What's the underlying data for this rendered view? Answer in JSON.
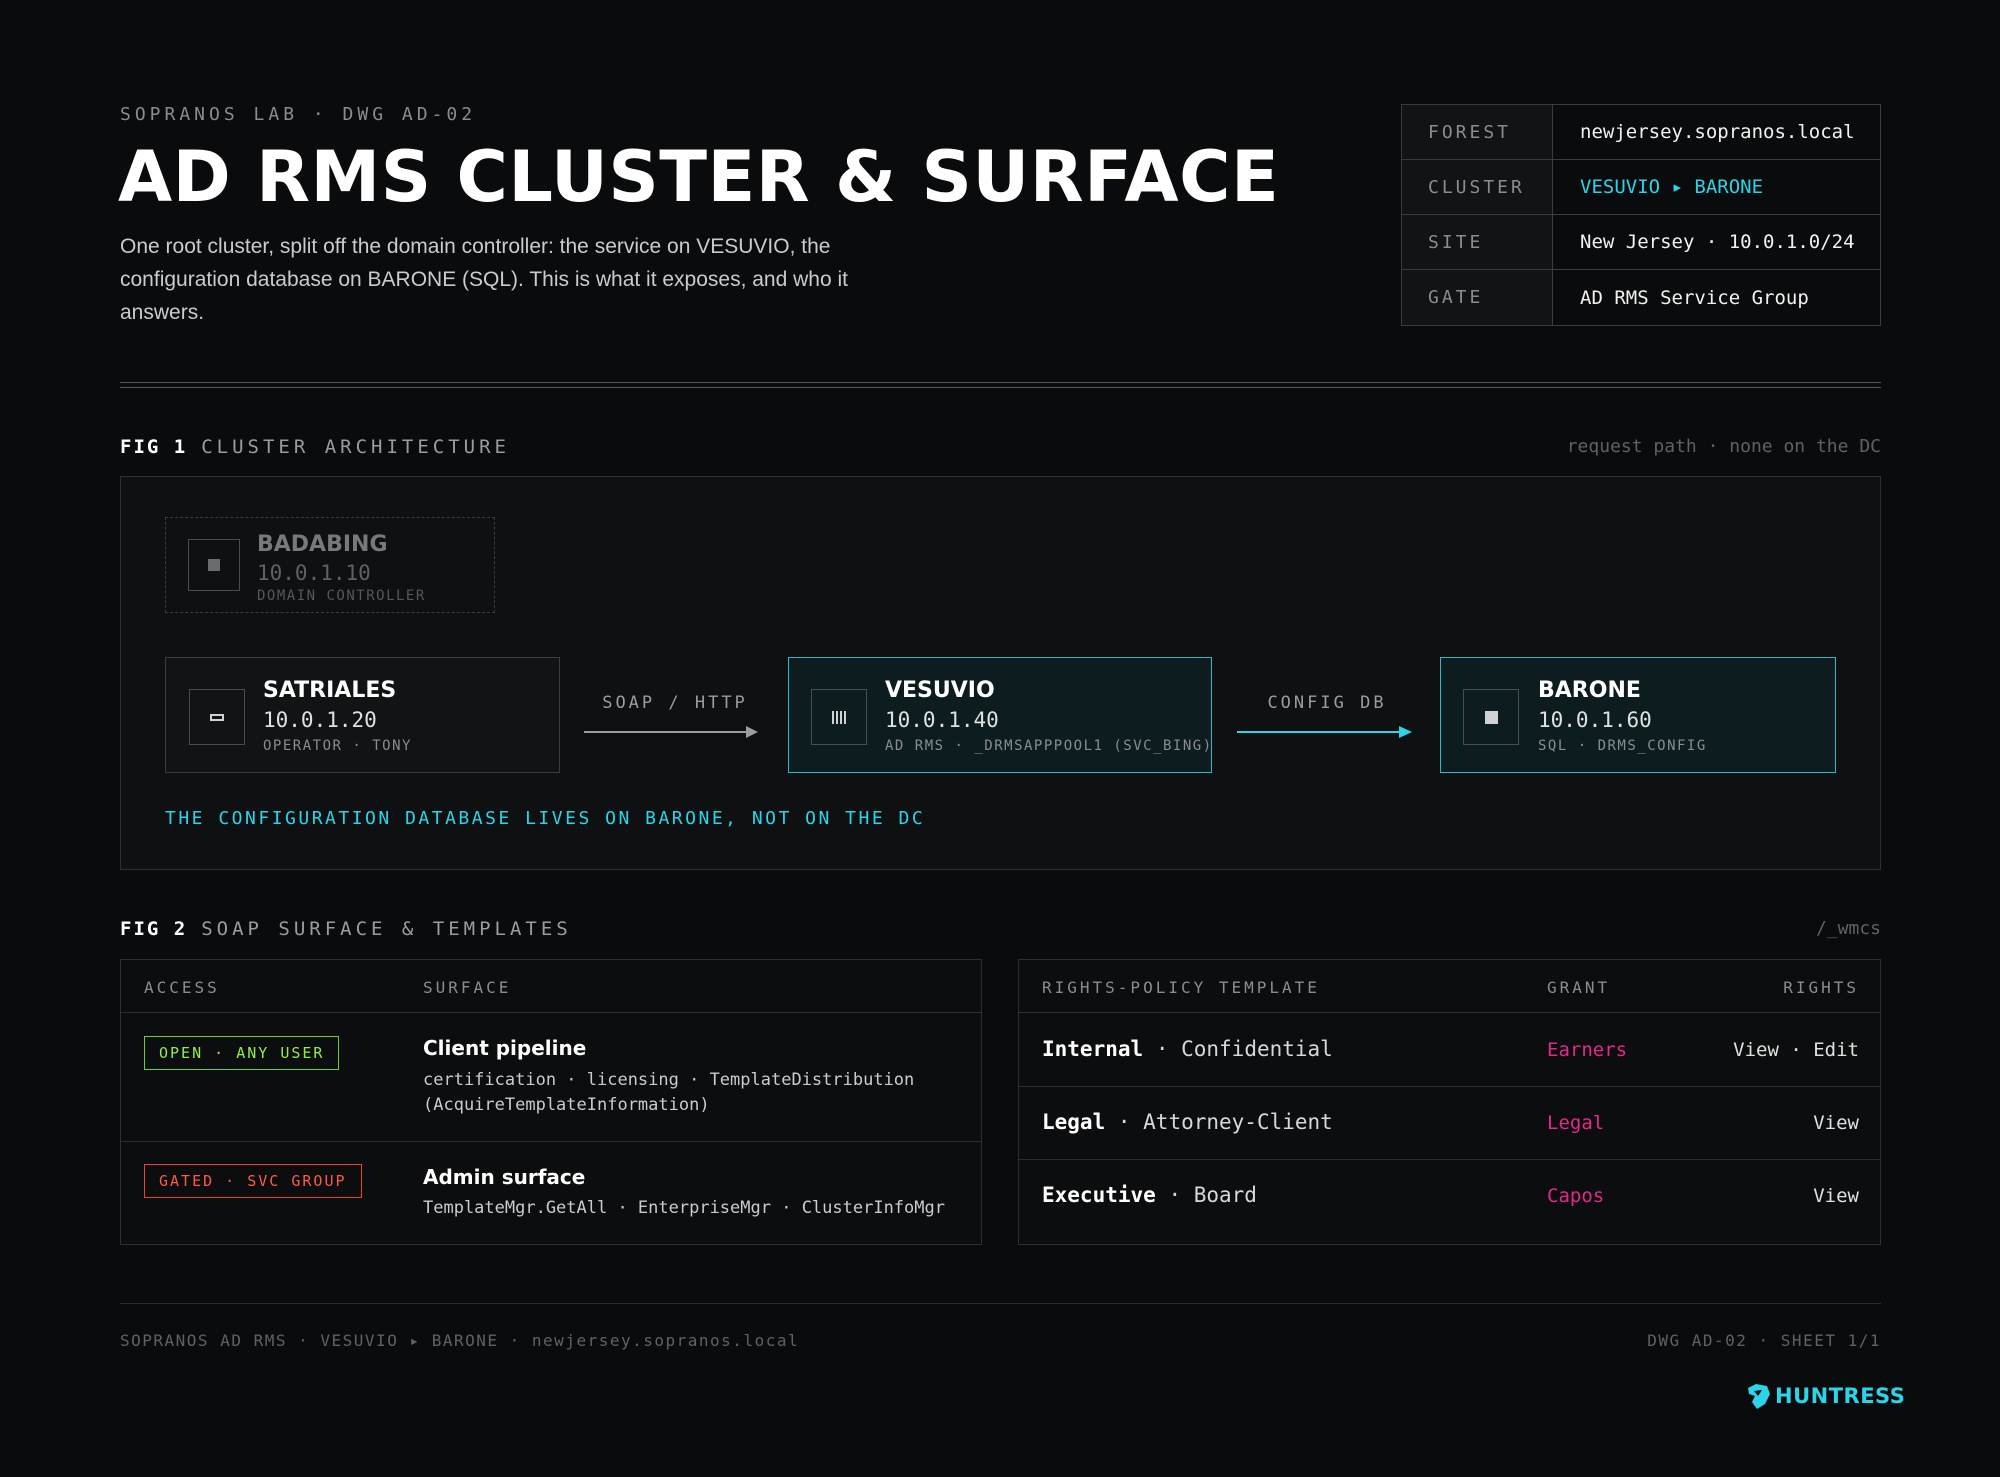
{
  "header": {
    "eyebrow": "SOPRANOS LAB · DWG AD-02",
    "title": "AD RMS CLUSTER & SURFACE",
    "lede": "One root cluster, split off the domain controller: the service on VESUVIO, the configuration database on BARONE (SQL). This is what it exposes, and who it answers."
  },
  "meta": [
    {
      "key": "FOREST",
      "value": "newjersey.sopranos.local"
    },
    {
      "key": "CLUSTER",
      "value": "VESUVIO ▸ BARONE"
    },
    {
      "key": "SITE",
      "value": "New Jersey · 10.0.1.0/24"
    },
    {
      "key": "GATE",
      "value": "AD RMS Service Group"
    }
  ],
  "fig1": {
    "num": "FIG 1",
    "title": "CLUSTER ARCHITECTURE",
    "note": "request path · none on the DC",
    "nodes": {
      "dc": {
        "name": "BADABING",
        "ip": "10.0.1.10",
        "role": "DOMAIN CONTROLLER"
      },
      "client": {
        "name": "SATRIALES",
        "ip": "10.0.1.20",
        "role": "OPERATOR · TONY"
      },
      "service": {
        "name": "VESUVIO",
        "ip": "10.0.1.40",
        "role": "AD RMS · _DRMSAPPPOOL1 (SVC_BING)"
      },
      "db": {
        "name": "BARONE",
        "ip": "10.0.1.60",
        "role": "SQL · DRMS_CONFIG"
      }
    },
    "edges": {
      "soap": "SOAP / HTTP",
      "config": "CONFIG DB"
    },
    "callout": "THE CONFIGURATION DATABASE LIVES ON BARONE, NOT ON THE DC"
  },
  "fig2": {
    "num": "FIG 2",
    "title": "SOAP SURFACE & TEMPLATES",
    "note": "/_wmcs",
    "surface": {
      "headers": {
        "access": "ACCESS",
        "surface": "SURFACE"
      },
      "rows": [
        {
          "badge": "OPEN · ANY USER",
          "title": "Client pipeline",
          "detail": "certification · licensing · TemplateDistribution (AcquireTemplateInformation)"
        },
        {
          "badge": "GATED · SVC GROUP",
          "title": "Admin surface",
          "detail": "TemplateMgr.GetAll · EnterpriseMgr · ClusterInfoMgr"
        }
      ]
    },
    "templates": {
      "headers": {
        "template": "RIGHTS-POLICY TEMPLATE",
        "grant": "GRANT",
        "rights": "RIGHTS"
      },
      "rows": [
        {
          "name": "Internal",
          "qualifier": "· Confidential",
          "grant": "Earners",
          "rights": "View · Edit"
        },
        {
          "name": "Legal",
          "qualifier": "· Attorney-Client",
          "grant": "Legal",
          "rights": "View"
        },
        {
          "name": "Executive",
          "qualifier": "· Board",
          "grant": "Capos",
          "rights": "View"
        }
      ]
    }
  },
  "footer": {
    "left": "SOPRANOS AD RMS · VESUVIO ▸ BARONE · newjersey.sopranos.local",
    "right": "DWG AD-02 · SHEET 1/1",
    "brand": "HUNTRESS"
  },
  "colors": {
    "accent": "#2bd4e8",
    "open": "#8ff04a",
    "gated": "#ff5a43",
    "grant": "#e5288a"
  }
}
